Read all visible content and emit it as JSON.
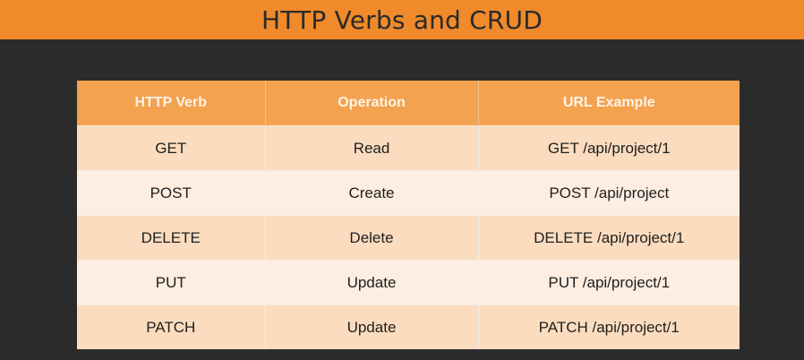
{
  "slide": {
    "title": "HTTP Verbs and CRUD"
  },
  "table": {
    "headers": [
      "HTTP Verb",
      "Operation",
      "URL Example"
    ],
    "rows": [
      [
        "GET",
        "Read",
        "GET /api/project/1"
      ],
      [
        "POST",
        "Create",
        "POST /api/project"
      ],
      [
        "DELETE",
        "Delete",
        "DELETE /api/project/1"
      ],
      [
        "PUT",
        "Update",
        "PUT /api/project/1"
      ],
      [
        "PATCH",
        "Update",
        "PATCH /api/project/1"
      ]
    ]
  },
  "colors": {
    "title_bar": "#f08a2a",
    "background": "#2b2b2b",
    "header": "#f3a24f",
    "row_odd": "#fbdcbf",
    "row_even": "#fdeee1"
  }
}
